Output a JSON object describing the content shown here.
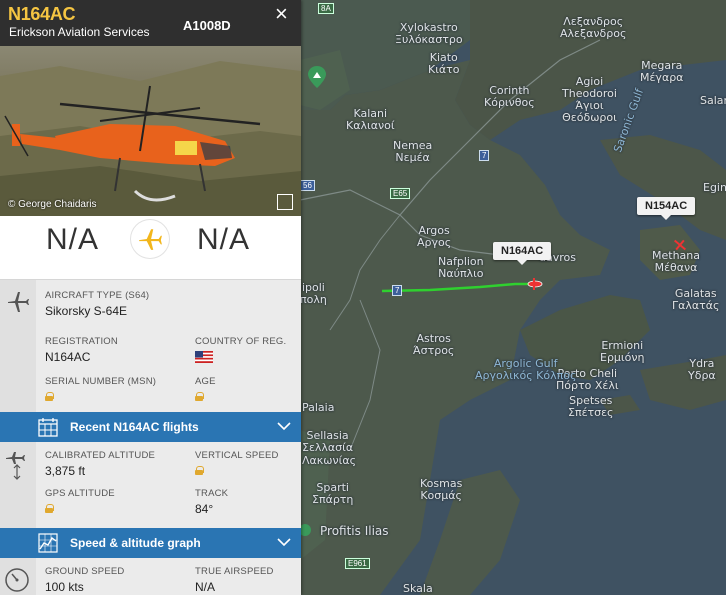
{
  "header": {
    "callsign": "N164AC",
    "airline": "Erickson Aviation Services",
    "hex": "A1008D",
    "close_label": "×"
  },
  "photo": {
    "credit": "© George Chaidaris"
  },
  "route": {
    "origin": "N/A",
    "destination": "N/A"
  },
  "aircraft": {
    "type_label": "AIRCRAFT TYPE",
    "type_code": "(S64)",
    "type_value": "Sikorsky S-64E",
    "registration_label": "REGISTRATION",
    "registration_value": "N164AC",
    "country_label": "COUNTRY OF REG.",
    "country_flag": "us-flag-icon",
    "serial_label": "SERIAL NUMBER (MSN)",
    "age_label": "AGE"
  },
  "recent_flights": {
    "label": "Recent N164AC flights"
  },
  "altitude": {
    "calibrated_label": "CALIBRATED ALTITUDE",
    "calibrated_value": "3,875 ft",
    "vertical_label": "VERTICAL SPEED",
    "gps_label": "GPS ALTITUDE",
    "track_label": "TRACK",
    "track_value": "84°"
  },
  "graph": {
    "label": "Speed & altitude graph"
  },
  "speed": {
    "ground_label": "GROUND SPEED",
    "ground_value": "100 kts",
    "true_label": "TRUE AIRSPEED",
    "true_value": "N/A"
  },
  "map": {
    "tags": {
      "n164": "N164AC",
      "n154": "N154AC"
    },
    "places": {
      "xylokastro": "Xylokastro\nΞυλόκαστρο",
      "kiato": "Kiato\nΚιάτο",
      "corinth": "Corinth\nΚόρινθος",
      "agioi": "Agioi\nTheodoroi\nΆγιοι\nΘεόδωροι",
      "megara": "Megara\nΜέγαρα",
      "alexia": "Λεξανδρος\nΑλεξανδρος",
      "kalani": "Kalani\nΚαλιανοί",
      "nemea": "Nemea\nΝεμέα",
      "argos": "Argos\nΑργος",
      "nafplion": "Nafplion\nΝαύπλιο",
      "methana": "Methana\nΜέθανα",
      "galatas": "Galatas\nΓαλατάς",
      "astros": "Astros\nΆστρος",
      "ermioni": "Ermioni\nΕρμιόνη",
      "porto": "Porto Cheli\nΠόρτο Χέλι",
      "spetses": "Spetses\nΣπέτσες",
      "ydra": "Ydra\nΥδρα",
      "sellasia": "Sellasia\nΣελλασία",
      "kosmas": "Kosmas\nΚοσμάς",
      "sparti": "Sparti\nΣπάρτη",
      "profitis": "Profitis Ilias",
      "skala": "Skala",
      "tripoli": "ipoli\nπολη",
      "gulf_argolic": "Argolic Gulf\nΑργολικός Κόλπος",
      "gulf_saronic": "Saronic Gulf",
      "salam": "Salam",
      "egin": "Egin",
      "ydra_gr": "Υδρα",
      "palaia": "Palaia",
      "lakonias": "Λακωνίας",
      "epidavros": "davros"
    },
    "roads": [
      "8A",
      "7",
      "E65",
      "56",
      "E961",
      "7"
    ]
  }
}
